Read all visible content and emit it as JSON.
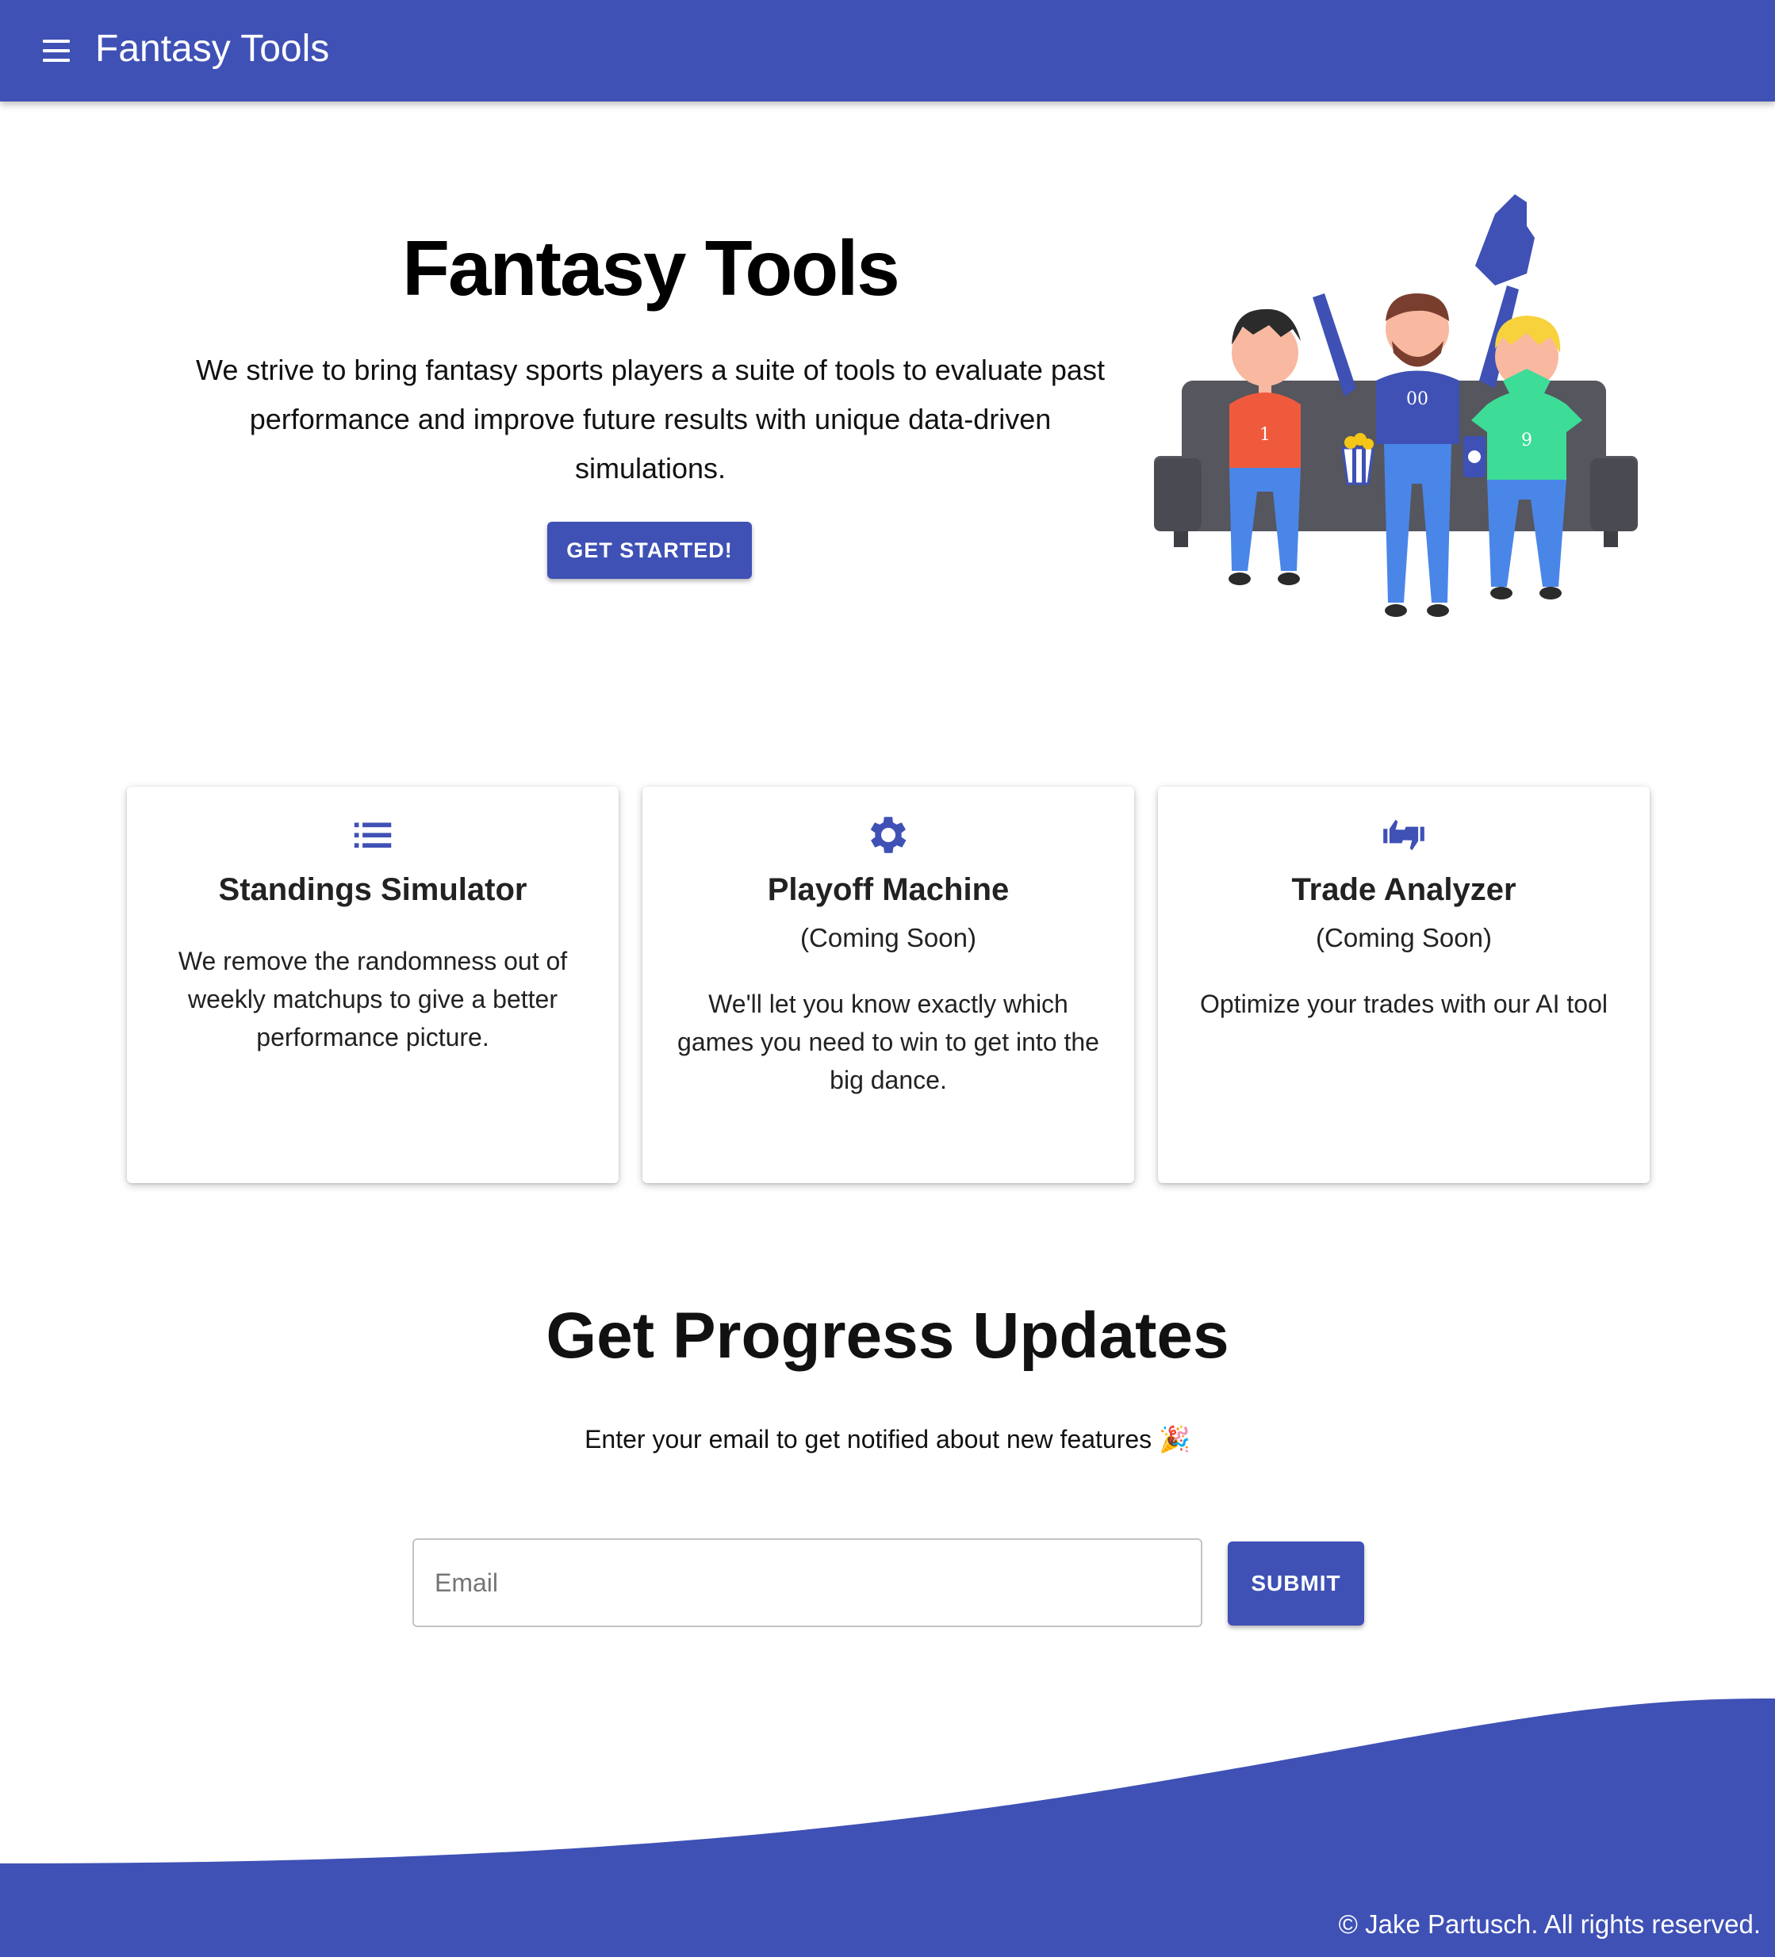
{
  "colors": {
    "primary": "#3f51b5",
    "background": "#ffffff",
    "text": "#000000"
  },
  "appbar": {
    "title": "Fantasy Tools",
    "menu_icon": "hamburger-menu-icon"
  },
  "hero": {
    "title": "Fantasy Tools",
    "description": "We strive to bring fantasy sports players a suite of tools to evaluate past performance and improve future results with unique data-driven simulations.",
    "cta_label": "GET STARTED!",
    "illustration": "fans-on-couch-illustration",
    "jersey_numbers": [
      "1",
      "00",
      "9"
    ]
  },
  "features": [
    {
      "icon": "list-icon",
      "title": "Standings Simulator",
      "subtitle": "",
      "description": "We remove the randomness out of weekly matchups to give a better performance picture."
    },
    {
      "icon": "gear-icon",
      "title": "Playoff Machine",
      "subtitle": "(Coming Soon)",
      "description": "We'll let you know exactly which games you need to win to get into the big dance."
    },
    {
      "icon": "thumbs-up-down-icon",
      "title": "Trade Analyzer",
      "subtitle": "(Coming Soon)",
      "description": "Optimize your trades with our AI tool"
    }
  ],
  "updates": {
    "title": "Get Progress Updates",
    "description": "Enter your email to get notified about new features 🎉",
    "email_placeholder": "Email",
    "email_value": "",
    "submit_label": "SUBMIT"
  },
  "footer": {
    "copyright": "© Jake Partusch. All rights reserved."
  }
}
